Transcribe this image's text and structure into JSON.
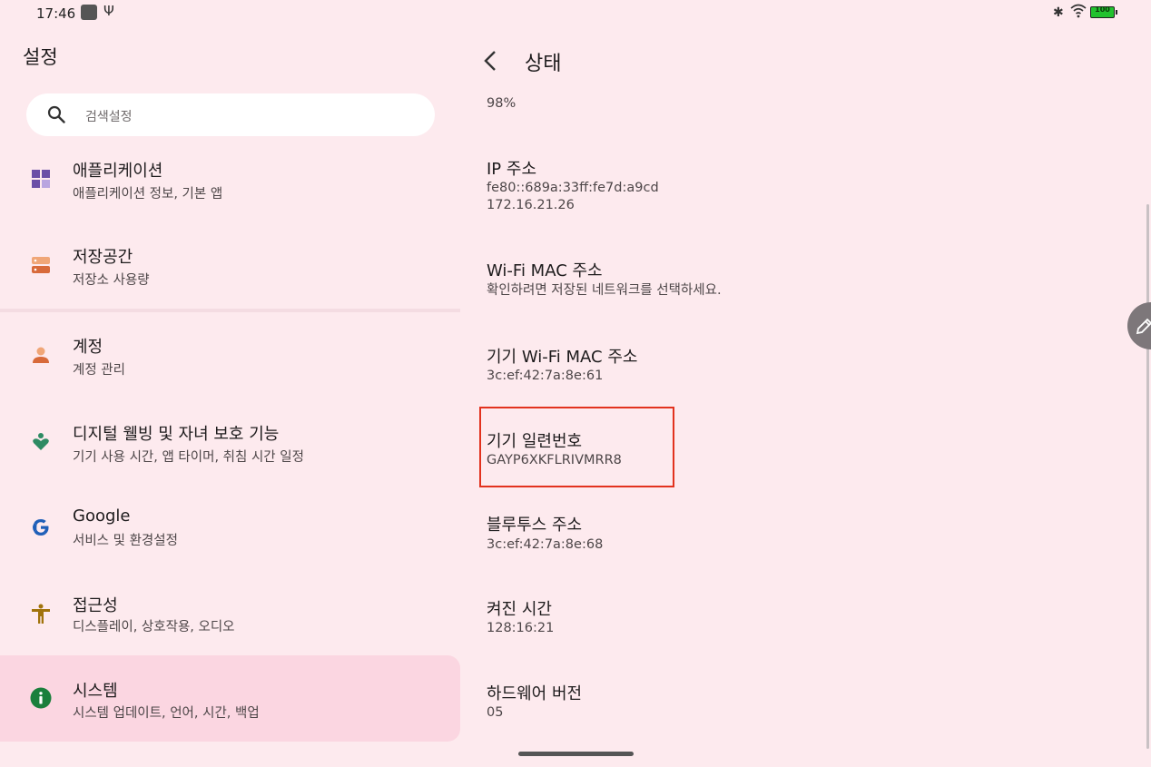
{
  "status_bar": {
    "time": "17:46",
    "usb_glyph": "Ψ",
    "bt_glyph": "✱",
    "battery_level": "100"
  },
  "left": {
    "title": "설정",
    "search_placeholder": "검색설정",
    "items": [
      {
        "title": "애플리케이션",
        "subtitle": "애플리케이션 정보, 기본 앱",
        "icon": "apps-icon"
      },
      {
        "title": "저장공간",
        "subtitle": "저장소 사용량",
        "icon": "storage-icon"
      },
      {
        "title": "계정",
        "subtitle": "계정 관리",
        "icon": "account-icon"
      },
      {
        "title": "디지털 웰빙 및 자녀 보호 기능",
        "subtitle": "기기 사용 시간, 앱 타이머, 취침 시간 일정",
        "icon": "wellbeing-icon"
      },
      {
        "title": "Google",
        "subtitle": "서비스 및 환경설정",
        "icon": "google-icon"
      },
      {
        "title": "접근성",
        "subtitle": "디스플레이, 상호작용, 오디오",
        "icon": "accessibility-icon"
      },
      {
        "title": "시스템",
        "subtitle": "시스템 업데이트, 언어, 시간, 백업",
        "icon": "info-icon"
      }
    ]
  },
  "right": {
    "title": "상태",
    "top_value": "98%",
    "entries": [
      {
        "title": "IP 주소",
        "value_line1": "fe80::689a:33ff:fe7d:a9cd",
        "value_line2": "172.16.21.26"
      },
      {
        "title": "Wi-Fi MAC 주소",
        "value": "확인하려면 저장된 네트워크를 선택하세요."
      },
      {
        "title": "기기 Wi-Fi MAC 주소",
        "value": "3c:ef:42:7a:8e:61"
      },
      {
        "title": "기기 일련번호",
        "value": "GAYP6XKFLRIVMRR8"
      },
      {
        "title": "블루투스 주소",
        "value": "3c:ef:42:7a:8e:68"
      },
      {
        "title": "켜진 시간",
        "value": "128:16:21"
      },
      {
        "title": "하드웨어 버전",
        "value": "05"
      }
    ]
  },
  "colors": {
    "background": "#fdeaee",
    "selected": "#fbd6e1",
    "highlight": "#e2321e"
  }
}
